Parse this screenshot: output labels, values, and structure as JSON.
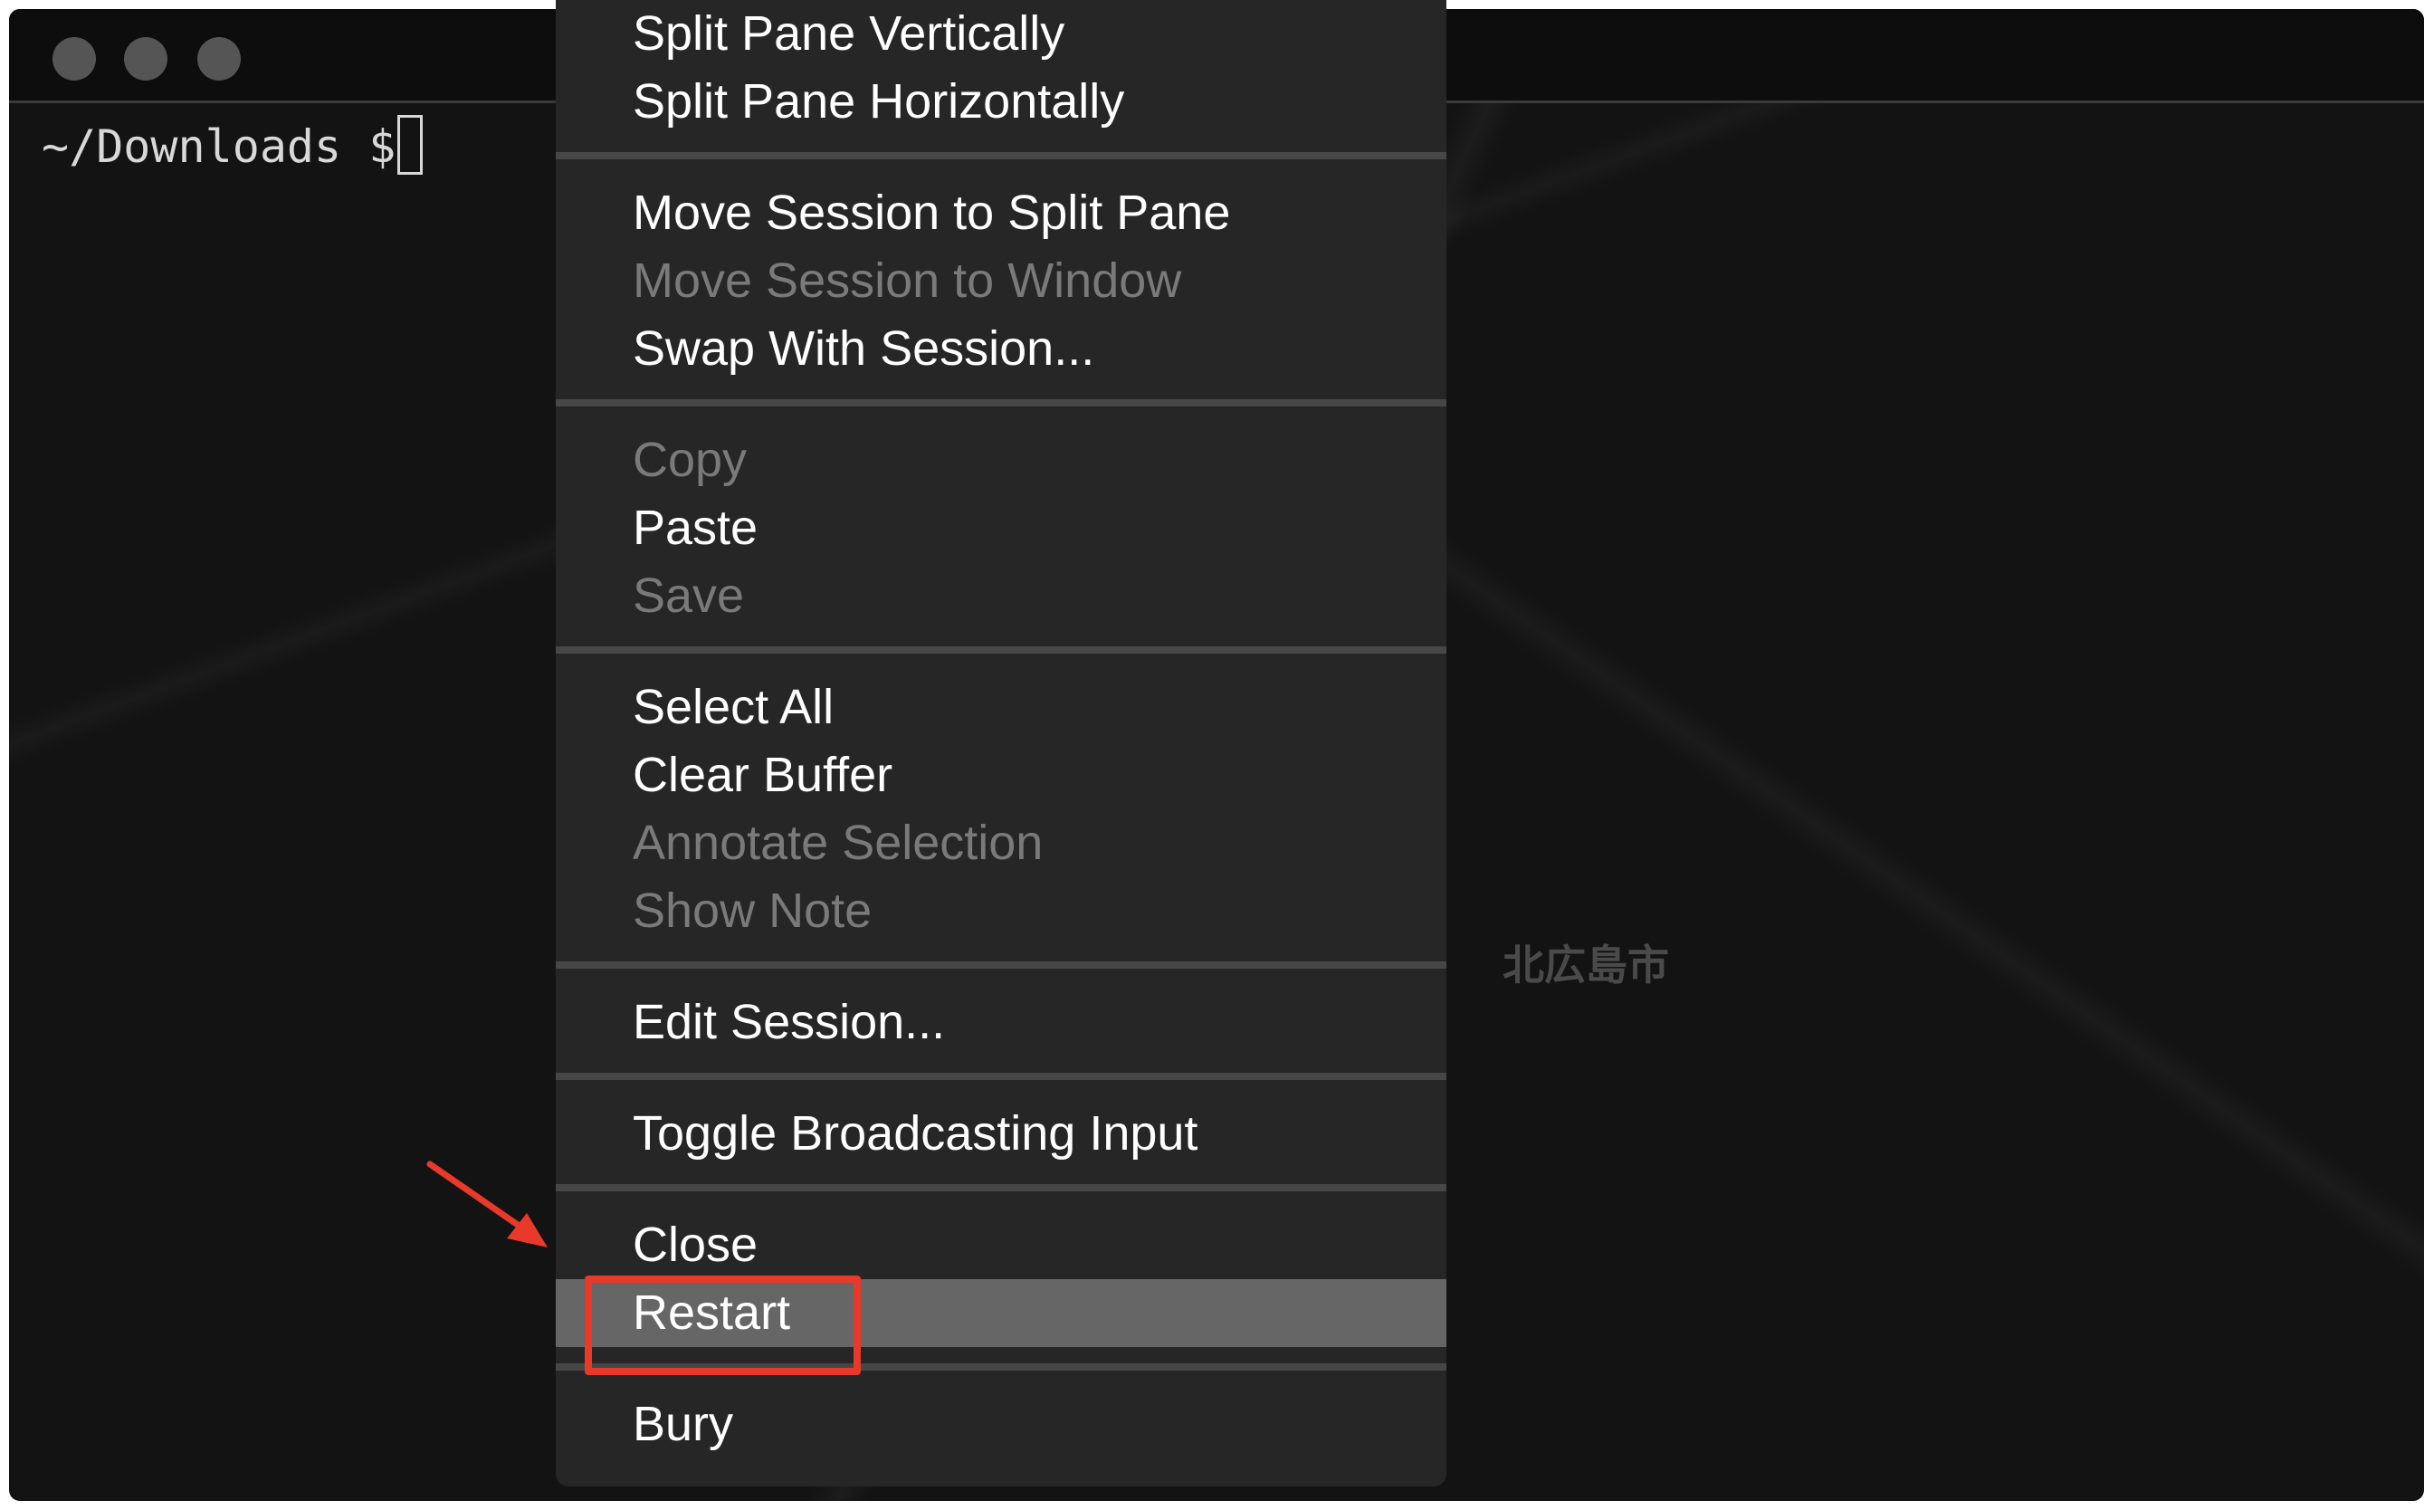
{
  "terminal": {
    "prompt": "~/Downloads $",
    "map_label": "北広島市"
  },
  "window_controls": [
    "close",
    "minimize",
    "zoom"
  ],
  "context_menu": {
    "groups": [
      [
        {
          "label": "Split Pane Vertically",
          "enabled": true
        },
        {
          "label": "Split Pane Horizontally",
          "enabled": true
        }
      ],
      [
        {
          "label": "Move Session to Split Pane",
          "enabled": true
        },
        {
          "label": "Move Session to Window",
          "enabled": false
        },
        {
          "label": "Swap With Session...",
          "enabled": true
        }
      ],
      [
        {
          "label": "Copy",
          "enabled": false
        },
        {
          "label": "Paste",
          "enabled": true
        },
        {
          "label": "Save",
          "enabled": false
        }
      ],
      [
        {
          "label": "Select All",
          "enabled": true
        },
        {
          "label": "Clear Buffer",
          "enabled": true
        },
        {
          "label": "Annotate Selection",
          "enabled": false
        },
        {
          "label": "Show Note",
          "enabled": false
        }
      ],
      [
        {
          "label": "Edit Session...",
          "enabled": true
        }
      ],
      [
        {
          "label": "Toggle Broadcasting Input",
          "enabled": true
        }
      ],
      [
        {
          "label": "Close",
          "enabled": true
        },
        {
          "label": "Restart",
          "enabled": true,
          "highlighted": true
        }
      ],
      [
        {
          "label": "Bury",
          "enabled": true
        }
      ]
    ]
  },
  "annotation": {
    "target": "Restart",
    "color": "#e8392a"
  }
}
